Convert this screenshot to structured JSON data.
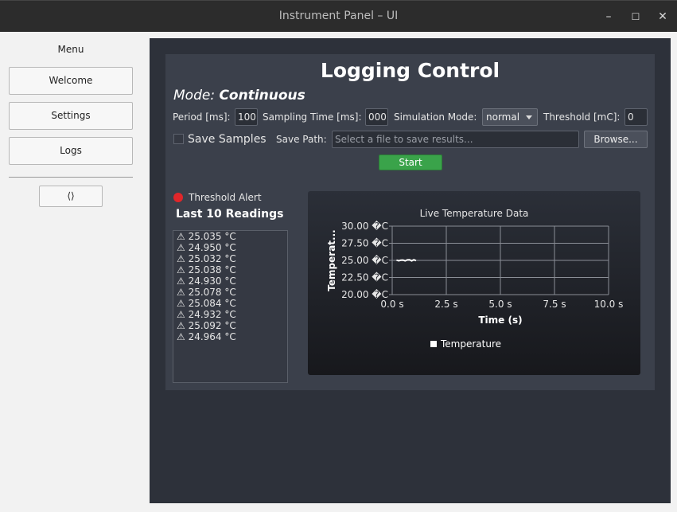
{
  "window": {
    "title": "Instrument Panel – UI",
    "controls": [
      "–",
      "☐",
      "✕"
    ]
  },
  "sidebar": {
    "menu_label": "Menu",
    "items": [
      {
        "label": "Welcome"
      },
      {
        "label": "Settings"
      },
      {
        "label": "Logs"
      }
    ],
    "extra_button": "⟨⟩"
  },
  "panel": {
    "title": "Logging Control",
    "mode_prefix": "Mode:",
    "mode_value": "Continuous",
    "period_label": "Period [ms]:",
    "period_value": "100",
    "sampling_label": "Sampling Time [ms]:",
    "sampling_value": "000",
    "simulation_label": "Simulation Mode:",
    "simulation_value": "normal",
    "threshold_label": "Threshold [mC]:",
    "threshold_value": "0",
    "save_samples_label": "Save Samples",
    "save_samples_checked": false,
    "save_path_label": "Save Path:",
    "save_path_placeholder": "Select a file to save results...",
    "browse_label": "Browse...",
    "start_label": "Start",
    "threshold_alert_label": "Threshold Alert",
    "readings_title": "Last 10 Readings",
    "readings": [
      "⚠ 25.035 °C",
      "⚠ 24.950 °C",
      "⚠ 25.032 °C",
      "⚠ 25.038 °C",
      "⚠ 24.930 °C",
      "⚠ 25.078 °C",
      "⚠ 25.084 °C",
      "⚠ 24.932 °C",
      "⚠ 25.092 °C",
      "⚠ 24.964 °C"
    ]
  },
  "colors": {
    "alert": "#e0262a",
    "start": "#3aa34a",
    "main_bg": "#2d313a",
    "panel_bg": "#3b404b"
  },
  "chart_data": {
    "type": "line",
    "title": "Live Temperature Data",
    "xlabel": "Time (s)",
    "ylabel": "Temperat...",
    "xlim": [
      0,
      10
    ],
    "ylim": [
      20,
      30
    ],
    "x_ticks": [
      "0.0 s",
      "2.5 s",
      "5.0 s",
      "7.5 s",
      "10.0 s"
    ],
    "y_ticks": [
      "30.00 �C",
      "27.50 �C",
      "25.00 �C",
      "22.50 �C",
      "20.00 �C"
    ],
    "grid": true,
    "legend_position": "bottom-center",
    "series": [
      {
        "name": "Temperature",
        "color": "#ffffff",
        "x": [
          0.2,
          0.3,
          0.4,
          0.5,
          0.6,
          0.7,
          0.8,
          0.9,
          1.0,
          1.1
        ],
        "y": [
          25.035,
          24.95,
          25.032,
          25.038,
          24.93,
          25.078,
          25.084,
          24.932,
          25.092,
          24.964
        ]
      }
    ]
  }
}
